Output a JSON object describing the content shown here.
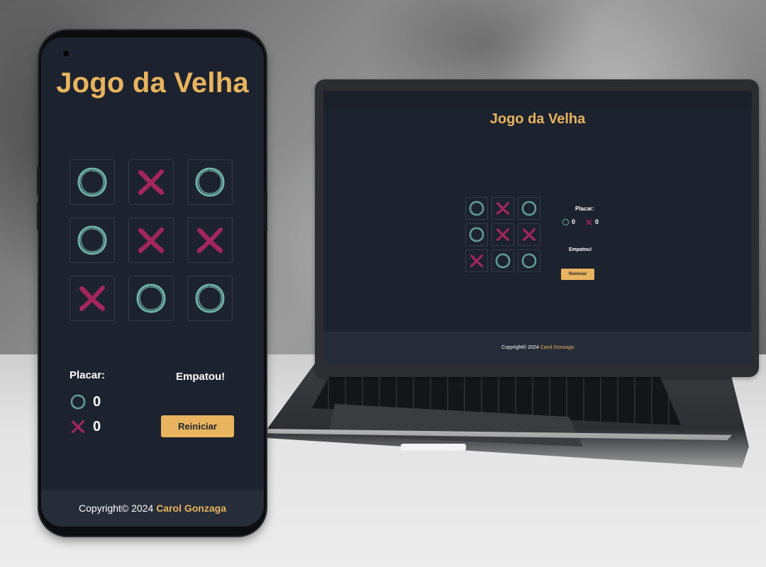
{
  "app": {
    "title": "Jogo da Velha",
    "board": [
      "O",
      "X",
      "O",
      "O",
      "X",
      "X",
      "X",
      "O",
      "O"
    ],
    "score": {
      "label": "Placar:",
      "o": "0",
      "x": "0"
    },
    "status": "Empatou!",
    "reset_label": "Reiniciar",
    "footer": {
      "prefix": "Copyright© 2024",
      "author": "Carol Gonzaga"
    }
  },
  "colors": {
    "background": "#1d232e",
    "accent": "#e8b45f",
    "o_mark": "#6fb5a9",
    "x_mark": "#a3265d",
    "footer": "#272d38"
  },
  "icons": {
    "o": "circle-mark-icon",
    "x": "cross-mark-icon"
  }
}
